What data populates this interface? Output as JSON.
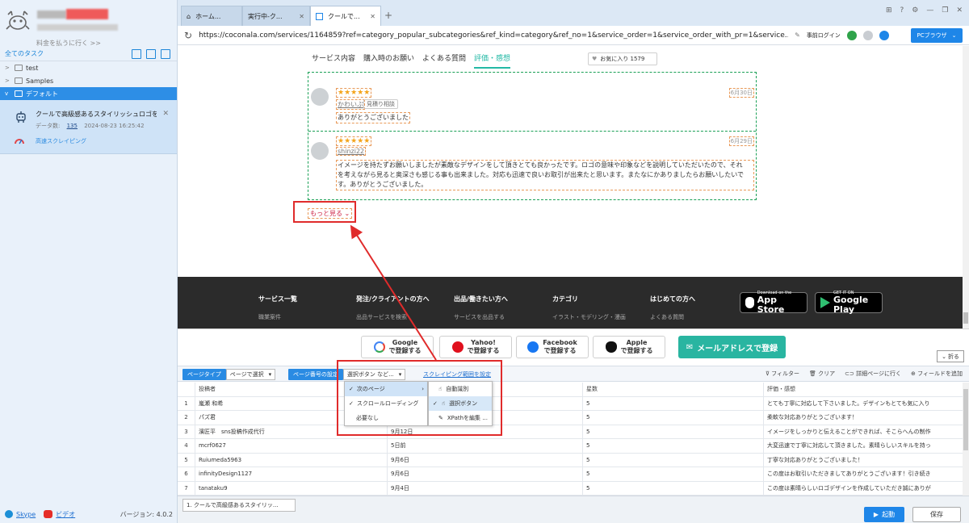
{
  "sidebar": {
    "pay_link": "料金を払うに行く >>",
    "all_tasks": "全てのタスク",
    "folders": [
      "test",
      "Samples"
    ],
    "active_folder": "デフォルト",
    "task": {
      "name": "クールで高級感あるスタイリッシュロゴを...",
      "count_label": "データ数:",
      "count": "135",
      "timestamp": "2024-08-23 16:25:42",
      "mode": "高速スクレイピング"
    },
    "footer": {
      "skype": "Skype",
      "video": "ビデオ",
      "version": "バージョン: 4.0.2"
    }
  },
  "browser": {
    "tabs": [
      "ホーム...",
      "実行中-ク...",
      "クールで..."
    ],
    "url": "https://coconala.com/services/1164859?ref=category_popular_subcategories&ref_kind=category&ref_no=1&service_order=1&service_order_with_pr=1&service...",
    "login": "事前ログイン",
    "pc_browser": "PCブラウザ"
  },
  "page": {
    "subnav": [
      "サービス内容",
      "購入時のお願い",
      "よくある質問",
      "評価・感想"
    ],
    "favorite": "お気に入り  1579",
    "reviews": [
      {
        "stars": "★★★★★",
        "name": "かわいぷ",
        "tag": "見積り相談",
        "date": "6月30日",
        "text": "ありがとうございました"
      },
      {
        "stars": "★★★★★",
        "name": "shinzi22",
        "date": "6月29日",
        "text1": "イメージを持たずお願いしましたが素敵なデザインをして頂きとても良かったです。ロゴの意味や印象などを説明していただいたので、それ",
        "text2": "を考えながら見ると奥深さも感じる事も出来ました。対応も迅速で良いお取引が出来たと思います。またなにかありましたらお願いしたいで",
        "text3": "す。ありがとうございました。"
      }
    ],
    "more": "もっと見る",
    "footer_cols": [
      "サービス一覧",
      "発注/クライアントの方へ",
      "出品/働きたい方へ",
      "カテゴリ",
      "はじめての方へ"
    ],
    "footer_subs": [
      "職業案件",
      "出品サービスを検索",
      "サービスを出品する",
      "イラスト・モデリング・漫画",
      "よくある質問"
    ],
    "app_store": {
      "top": "Download on the",
      "main": "App Store"
    },
    "google_play": {
      "top": "GET IT ON",
      "main": "Google Play"
    }
  },
  "login_bar": {
    "google": [
      "Google",
      "で登録する"
    ],
    "yahoo": [
      "Yahoo!",
      "で登録する"
    ],
    "facebook": [
      "Facebook",
      "で登録する"
    ],
    "apple": [
      "Apple",
      "で登録する"
    ],
    "mail": "メールアドレスで登録",
    "fold": "折る"
  },
  "toolbar": {
    "page_type_label": "ページタイプ",
    "page_type_value": "ページで選択",
    "page_num_label": "ページ番号の設定",
    "page_num_value": "選択ボタン など...",
    "scrape_range": "スクレイピング範囲を設定",
    "filter": "フィルター",
    "clear": "クリア",
    "detail": "詳細ページに行く",
    "add_field": "フィールドを追加"
  },
  "dropdown": {
    "left": [
      "次のページ",
      "スクロールローディング",
      "必要なし"
    ],
    "right": [
      "自動識別",
      "選択ボタン",
      "XPathを編集 ..."
    ]
  },
  "table": {
    "headers": [
      "投稿者",
      "",
      "星数",
      "評価・感想"
    ],
    "rows": [
      [
        "1",
        "嵐瀬 和希",
        "",
        "5",
        "とても丁寧に対応して下さいました。デザインもとても気に入り"
      ],
      [
        "2",
        "パズ君",
        "",
        "5",
        "柔軟な対応ありがとうございます！"
      ],
      [
        "3",
        "濱匠平　sns投稿作成代行",
        "9月12日",
        "5",
        "イメージをしっかりと伝えることができれば、そこらへんの制作"
      ],
      [
        "4",
        "mcrf0627",
        "5日前",
        "5",
        "大変迅速で丁寧に対応して頂きました。素晴らしいスキルを持っ"
      ],
      [
        "5",
        "Ruiumeda5963",
        "9月6日",
        "5",
        "丁寧な対応ありがとうございました！"
      ],
      [
        "6",
        "infinityDesign1127",
        "9月6日",
        "5",
        "この度はお取引いただきましてありがとうございます！引き続き"
      ],
      [
        "7",
        "tanataku9",
        "9月4日",
        "5",
        "この度は素晴らしいロゴデザインを作成していただき誠にありが"
      ]
    ]
  },
  "bottom": {
    "task_tab": "1. クールで高級感あるスタイリッ...",
    "start": "起動",
    "save": "保存"
  }
}
